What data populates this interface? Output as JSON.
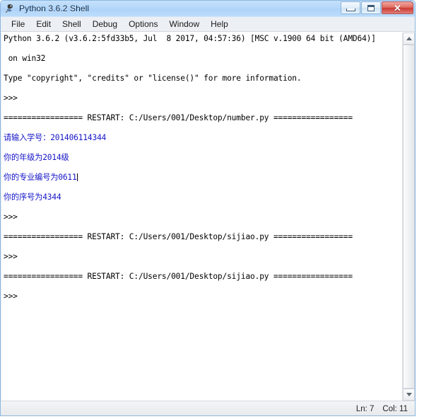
{
  "window": {
    "title": "Python 3.6.2 Shell",
    "icon": "python-idle-icon",
    "buttons": {
      "minimize": "minimize-button",
      "maximize": "maximize-button",
      "close": "close-button",
      "close_glyph": "✕"
    }
  },
  "menubar": {
    "items": [
      {
        "label": "File"
      },
      {
        "label": "Edit"
      },
      {
        "label": "Shell"
      },
      {
        "label": "Debug"
      },
      {
        "label": "Options"
      },
      {
        "label": "Window"
      },
      {
        "label": "Help"
      }
    ]
  },
  "console": {
    "lines": [
      {
        "text": "Python 3.6.2 (v3.6.2:5fd33b5, Jul  8 2017, 04:57:36) [MSC v.1900 64 bit (AMD64)]",
        "color": "black"
      },
      {
        "text": " on win32",
        "color": "black"
      },
      {
        "text": "Type \"copyright\", \"credits\" or \"license()\" for more information.",
        "color": "black"
      },
      {
        "text": ">>> ",
        "color": "black"
      },
      {
        "text": "================= RESTART: C:/Users/001/Desktop/number.py =================",
        "color": "black"
      },
      {
        "text": "请输入学号：201406114344",
        "color": "blue"
      },
      {
        "text": "你的年级为2014级",
        "color": "blue"
      },
      {
        "text": "你的专业编号为0611",
        "color": "blue",
        "cursor": true
      },
      {
        "text": "你的序号为4344",
        "color": "blue"
      },
      {
        "text": ">>> ",
        "color": "black"
      },
      {
        "text": "================= RESTART: C:/Users/001/Desktop/sijiao.py =================",
        "color": "black"
      },
      {
        "text": ">>> ",
        "color": "black"
      },
      {
        "text": "================= RESTART: C:/Users/001/Desktop/sijiao.py =================",
        "color": "black"
      },
      {
        "text": ">>> ",
        "color": "black"
      }
    ]
  },
  "scrollbar": {
    "up_arrow": "scroll-up-arrow",
    "down_arrow": "scroll-down-arrow"
  },
  "statusbar": {
    "line": "Ln: 7",
    "col": "Col: 11"
  },
  "colors": {
    "titlebar": "#b6d8fa",
    "output_blue": "#1515c8",
    "text_black": "#000000",
    "close_red": "#cc3b32"
  }
}
